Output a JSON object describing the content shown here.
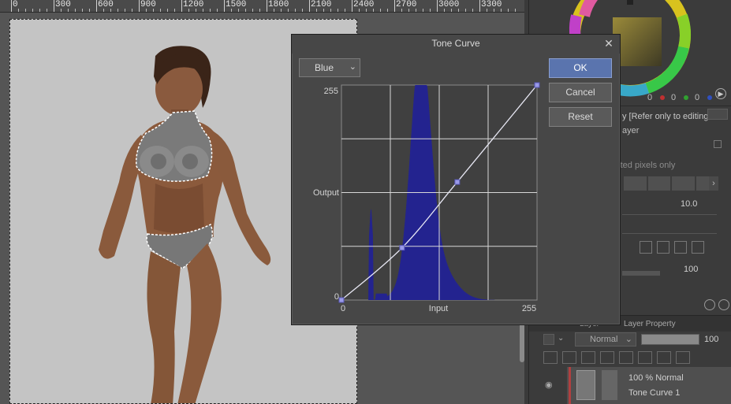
{
  "ruler": {
    "labels": [
      "0",
      "300",
      "600",
      "900",
      "1200",
      "1500",
      "1800",
      "2100",
      "2400",
      "2700",
      "3000",
      "3300"
    ]
  },
  "dialog": {
    "title": "Tone Curve",
    "channel": "Blue",
    "buttons": {
      "ok": "OK",
      "cancel": "Cancel",
      "reset": "Reset"
    },
    "graph": {
      "y_max_label": "255",
      "y_min_label": "0",
      "y_axis_label": "Output",
      "x_min_label": "0",
      "x_max_label": "255",
      "x_axis_label": "Input",
      "histogram_color": "#23238f",
      "curve_points": [
        [
          0,
          0
        ],
        [
          79,
          62
        ],
        [
          151,
          140
        ],
        [
          255,
          255
        ]
      ]
    }
  },
  "panel": {
    "color_values": [
      "0",
      "0",
      "0"
    ],
    "refer_text": "y [Refer only to editing la",
    "layer_text": "ayer",
    "selected_text": "ected pixels only",
    "value_1": "10.0",
    "value_2": "100",
    "tab_layer": "Layer",
    "tab_property": "Layer Property",
    "blend_mode": "Normal",
    "opacity": "100",
    "layer_item": {
      "opacity_mode": "100 % Normal",
      "name": "Tone Curve 1"
    }
  },
  "colors": {
    "accent": "#5a74ae",
    "histogram": "#23238f",
    "paper": "#c4c4c4"
  }
}
